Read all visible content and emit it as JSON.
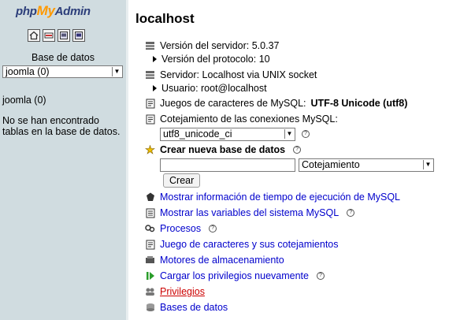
{
  "nav": {
    "logo_php": "php",
    "logo_my": "My",
    "logo_admin": "Admin",
    "icons": [
      "home-icon",
      "sql-query-icon",
      "query-window-icon",
      "docs-icon"
    ],
    "db_label": "Base de datos",
    "db_select_value": "joomla (0)",
    "db_name": "joomla (0)",
    "no_tables": "No se han encontrado tablas en la base de datos."
  },
  "main": {
    "title": "localhost",
    "server_version": "Versión del servidor: 5.0.37",
    "protocol_version": "Versión del protocolo: 10",
    "server": "Servidor: Localhost via UNIX socket",
    "user": "Usuario: root@localhost",
    "charsets_label": "Juegos de caracteres de MySQL:",
    "charsets_value": "UTF-8 Unicode (utf8)",
    "collation_label": "Cotejamiento de las conexiones MySQL:",
    "collation_value": "utf8_unicode_ci",
    "create_db_label": "Crear nueva base de datos",
    "create_db_input_value": "",
    "create_db_collation": "Cotejamiento",
    "create_button": "Crear",
    "links": [
      "Mostrar información de tiempo de ejecución de MySQL",
      "Mostrar las variables del sistema MySQL",
      "Procesos",
      "Juego de caracteres y sus cotejamientos",
      "Motores de almacenamiento",
      "Cargar los privilegios nuevamente",
      "Privilegios",
      "Bases de datos"
    ],
    "help_glyph": "?",
    "colors": {
      "link": "#0000cc",
      "link_active": "#cc0000",
      "nav_bg": "#d0dce0"
    }
  }
}
